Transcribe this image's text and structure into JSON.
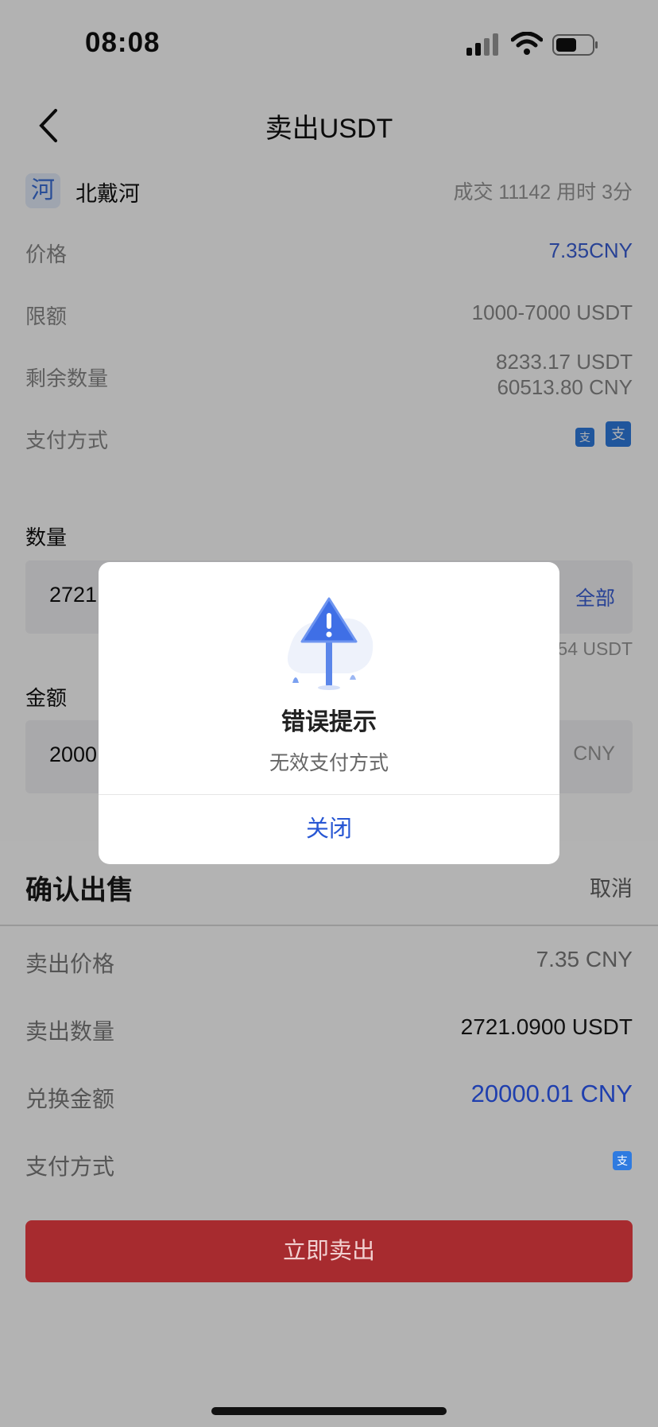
{
  "status_bar": {
    "time": "08:08"
  },
  "header": {
    "title": "卖出USDT"
  },
  "merchant": {
    "icon_char": "河",
    "name": "北戴河",
    "stats": "成交 11142 用时 3分"
  },
  "details": {
    "price_label": "价格",
    "price_value": "7.35CNY",
    "limit_label": "限额",
    "limit_value": "1000-7000 USDT",
    "remaining_label": "剩余数量",
    "remaining_usdt": "8233.17 USDT",
    "remaining_cny": "60513.80 CNY",
    "payment_label": "支付方式",
    "payment_badge": "支"
  },
  "form": {
    "quantity_label": "数量",
    "quantity_value": "2721.",
    "all_label": "全部",
    "quantity_hint": "54 USDT",
    "amount_label": "金额",
    "amount_value": "2000",
    "amount_unit": "CNY"
  },
  "sheet": {
    "title": "确认出售",
    "cancel": "取消",
    "price_label": "卖出价格",
    "price_value": "7.35 CNY",
    "quantity_label": "卖出数量",
    "quantity_value": "2721.0900 USDT",
    "amount_label": "兑换金额",
    "amount_value": "20000.01 CNY",
    "payment_label": "支付方式",
    "payment_badge": "支",
    "sell_button": "立即卖出"
  },
  "dialog": {
    "icon": "warning-sign-icon",
    "title": "错误提示",
    "message": "无效支付方式",
    "close": "关闭"
  },
  "colors": {
    "accent_blue": "#2756d3",
    "sell_red": "#a72b2f",
    "pay_blue": "#2f7be0"
  }
}
